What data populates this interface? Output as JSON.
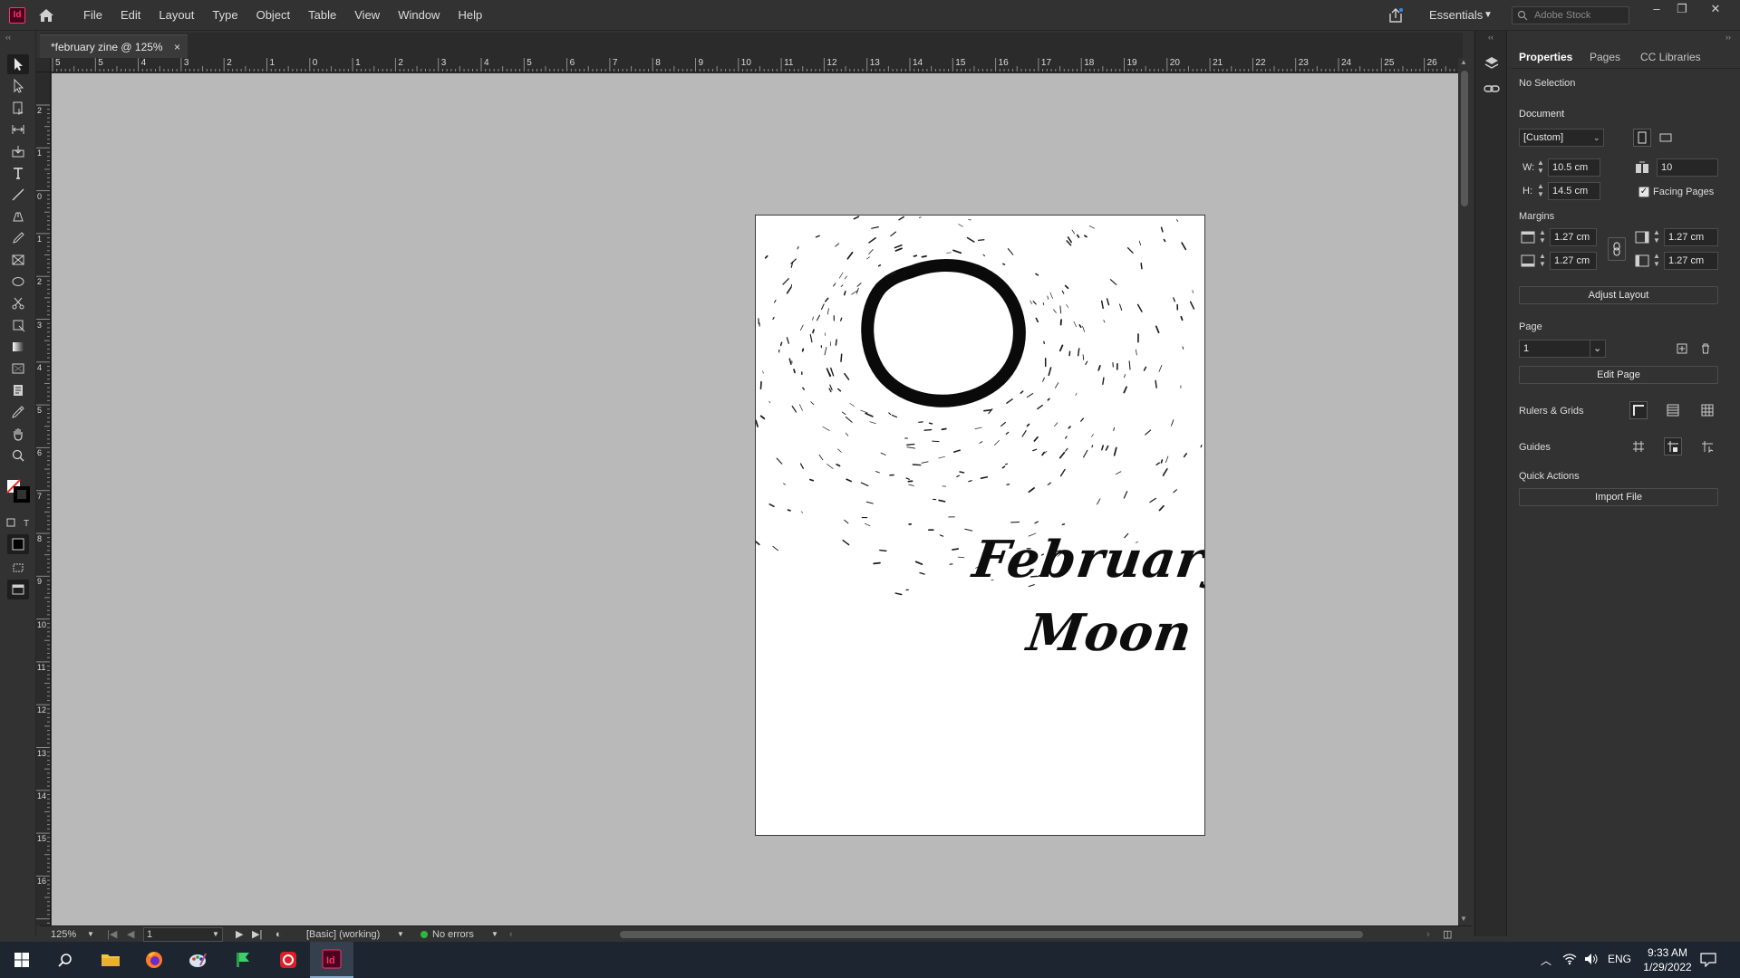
{
  "app": {
    "logo": "Id",
    "home_icon": "home-icon"
  },
  "menu": [
    "File",
    "Edit",
    "Layout",
    "Type",
    "Object",
    "Table",
    "View",
    "Window",
    "Help"
  ],
  "workspace": {
    "label": "Essentials"
  },
  "stock_search": {
    "placeholder": "Adobe Stock"
  },
  "document_tab": {
    "title": "*february zine @ 125%",
    "close": "×"
  },
  "hruler_labels": [
    "5",
    "5",
    "4",
    "3",
    "2",
    "1",
    "0",
    "1",
    "2",
    "3",
    "4",
    "5",
    "6",
    "7",
    "8",
    "9",
    "10",
    "11",
    "12",
    "13",
    "14",
    "15",
    "16",
    "17",
    "18",
    "19",
    "20",
    "21",
    "22",
    "23",
    "24",
    "25",
    "26"
  ],
  "vruler_labels": [
    "2",
    "1",
    "0",
    "1",
    "2",
    "3",
    "4",
    "5",
    "6",
    "7",
    "8",
    "9",
    "10",
    "11",
    "12",
    "13",
    "14",
    "15",
    "16"
  ],
  "page_content": {
    "line1": "February",
    "line2": "Moon"
  },
  "status_bar": {
    "zoom": "125%",
    "page": "1",
    "style": "[Basic] (working)",
    "preflight": "No errors"
  },
  "properties": {
    "tabs": [
      "Properties",
      "Pages",
      "CC Libraries"
    ],
    "selection": "No Selection",
    "document_label": "Document",
    "preset": "[Custom]",
    "w_label": "W:",
    "width": "10.5 cm",
    "h_label": "H:",
    "height": "14.5 cm",
    "pages": "10",
    "facing_pages": "Facing Pages",
    "margins_label": "Margins",
    "margin_top": "1.27 cm",
    "margin_bottom": "1.27 cm",
    "margin_inside": "1.27 cm",
    "margin_outside": "1.27 cm",
    "adjust_layout": "Adjust Layout",
    "page_label": "Page",
    "page_value": "1",
    "edit_page": "Edit Page",
    "rulers_grids": "Rulers & Grids",
    "guides": "Guides",
    "quick_actions": "Quick Actions",
    "import_file": "Import File"
  },
  "taskbar": {
    "time": "9:33 AM",
    "date": "1/29/2022",
    "language": "ENG"
  },
  "colors": {
    "accent_indesign": "#ff3366",
    "pasteboard": "#b9b9b9",
    "panel": "#323232",
    "status_ok": "#2db83d"
  }
}
